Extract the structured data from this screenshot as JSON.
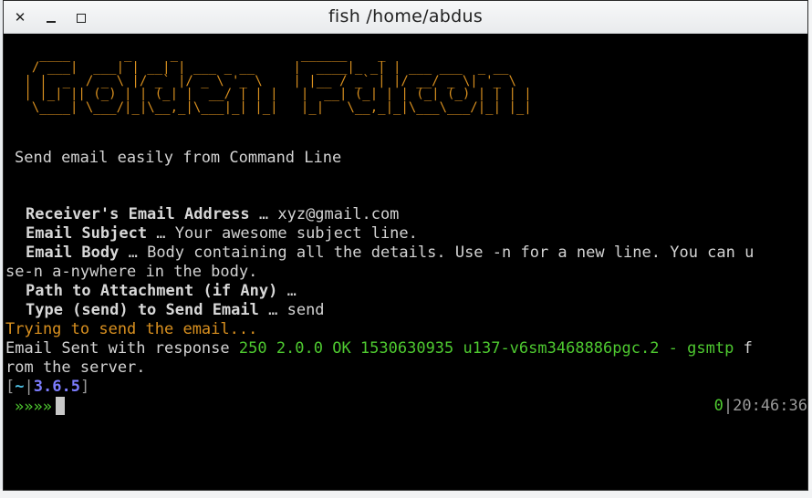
{
  "window": {
    "title": "fish /home/abdus",
    "close_label": "✕",
    "minimize_label": "",
    "maximize_label": ""
  },
  "banner_art": "   ____       _     _                ______    _\n  / ___|  ___| | __| | ___ _ __     |  ____|_ _| | ___ ___  _ __\n | |  _  / _ \\ |/ _` |/ _ \\ '_ \\    | |__ / _` | |/ __/ _ \\| '_ \\\n | |_| || (_) | | (_| |  __/ | | |   |  __| (_| | | (_| (_) | | | |\n  \\____| \\___/|_|\\__,_|\\___|_| |_|   |_|   \\__,_|_|\\___\\___/|_| |_|",
  "banner_text": "Golden Falcon",
  "tagline": "Send email easily from Command Line",
  "fields": [
    {
      "label": "Receiver's Email Address",
      "sep": " … ",
      "value": "xyz@gmail.com"
    },
    {
      "label": "Email Subject",
      "sep": " … ",
      "value": "Your awesome subject line."
    },
    {
      "label": "Email Body",
      "sep": " … ",
      "value": "Body containing all the details. Use -n for a new line. You can u"
    },
    {
      "label": "",
      "sep": "",
      "value": "se-n a-nywhere in the body."
    },
    {
      "label": "Path to Attachment (if Any)",
      "sep": " … ",
      "value": ""
    },
    {
      "label": "Type (send) to Send Email",
      "sep": " … ",
      "value": "send"
    }
  ],
  "status": {
    "trying": "Trying to send the email...",
    "sent_prefix": "Email Sent with response ",
    "sent_response": "250 2.0.0 OK 1530630935 u137-v6sm3468886pgc.2 - gsmtp",
    "sent_suffix_1": " f",
    "sent_suffix_2": "rom the server."
  },
  "prompt": {
    "open": "[",
    "dir": "~",
    "pipe": "|",
    "version": "3.6.5",
    "close": "]",
    "arrows": "»»»»",
    "right_status": "0",
    "right_sep": "|",
    "time": "20:46:36"
  },
  "colors": {
    "accent_orange": "#d9901f",
    "green": "#4ec930",
    "blue": "#7d7dff",
    "cyan": "#4fc3e8",
    "terminal_bg": "#000000"
  }
}
